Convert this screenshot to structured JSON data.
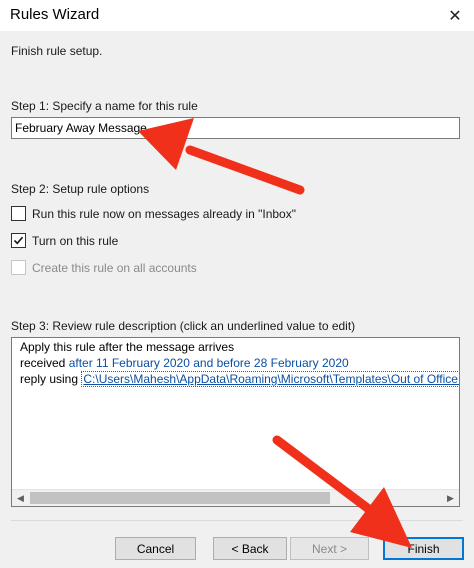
{
  "window": {
    "title": "Rules Wizard",
    "close_glyph": "✕"
  },
  "heading": "Finish rule setup.",
  "step1": {
    "label": "Step 1: Specify a name for this rule",
    "name_value": "February Away Message"
  },
  "step2": {
    "label": "Step 2: Setup rule options",
    "options": [
      {
        "label": "Run this rule now on messages already in \"Inbox\"",
        "checked": false,
        "enabled": true
      },
      {
        "label": "Turn on this rule",
        "checked": true,
        "enabled": true
      },
      {
        "label": "Create this rule on all accounts",
        "checked": false,
        "enabled": false
      }
    ]
  },
  "step3": {
    "label": "Step 3: Review rule description (click an underlined value to edit)",
    "line1": "Apply this rule after the message arrives",
    "line2_prefix": "received",
    "line2_link": "after 11 February 2020 and before 28 February 2020",
    "line3_prefix": "reply using",
    "line3_link": "C:\\Users\\Mahesh\\AppData\\Roaming\\Microsoft\\Templates\\Out of Office Me"
  },
  "buttons": {
    "cancel": "Cancel",
    "back": "< Back",
    "next": "Next >",
    "finish": "Finish"
  },
  "colors": {
    "accent": "#0078d7",
    "link": "#0b4fa3",
    "annotation_arrow": "#f0301a"
  }
}
